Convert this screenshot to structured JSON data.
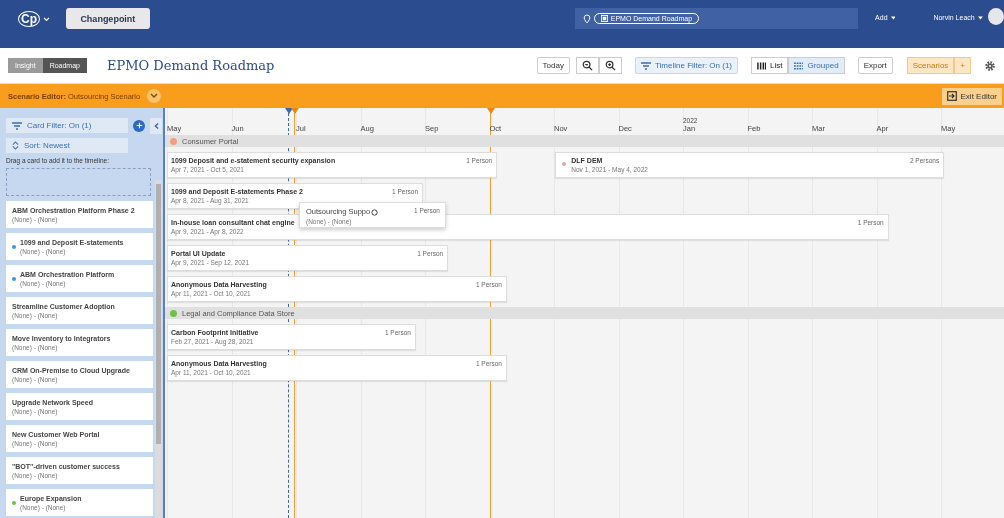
{
  "top_nav": {
    "logo": "Cp",
    "brand": "Changepoint",
    "breadcrumb": "EPMO Demand Roadmap",
    "add": "Add",
    "user": "Norvin Leach"
  },
  "toolbar": {
    "modes": [
      {
        "label": "Insight",
        "selected": false
      },
      {
        "label": "Roadmap",
        "selected": true
      }
    ],
    "title": "EPMO Demand Roadmap",
    "today": "Today",
    "timeline_filter": "Timeline Filter: On (1)",
    "views": [
      {
        "label": "List",
        "selected": false
      },
      {
        "label": "Grouped",
        "selected": true
      }
    ],
    "export": "Export",
    "scenarios": "Scenarios",
    "add_scenario": "+"
  },
  "scenario_bar": {
    "label": "Scenario Editor:",
    "name": "Outsourcing Scenario",
    "exit": "Exit Editor"
  },
  "sidebar": {
    "card_filter": "Card Filter: On (1)",
    "sort": "Sort: Newest",
    "hint": "Drag a card to add it to the timeline:",
    "cards": [
      {
        "title": "ABM Orchestration Platform Phase 2",
        "subtitle": "(None) - (None)"
      },
      {
        "title": "1099 and Deposit E-statements",
        "subtitle": "(None) - (None)",
        "color": "#3a9ad9"
      },
      {
        "title": "ABM Orchestration Platform",
        "subtitle": "(None) - (None)",
        "color": "#3a9ad9"
      },
      {
        "title": "Streamline Customer Adoption",
        "subtitle": "(None) - (None)"
      },
      {
        "title": "Move Inventory to Integrators",
        "subtitle": "(None) - (None)"
      },
      {
        "title": "CRM On-Premise to Cloud Upgrade",
        "subtitle": "(None) - (None)"
      },
      {
        "title": "Upgrade Network Speed",
        "subtitle": "(None) - (None)"
      },
      {
        "title": "New Customer Web Portal",
        "subtitle": "(None) - (None)"
      },
      {
        "title": "\"BOT\"-driven customer success",
        "subtitle": "(None) - (None)"
      },
      {
        "title": "Europe Expansion",
        "subtitle": "(None) - (None)",
        "color": "#6cc24a"
      }
    ]
  },
  "timeline": {
    "months": [
      {
        "label": "May"
      },
      {
        "label": "Jun"
      },
      {
        "label": "Jul"
      },
      {
        "label": "Aug"
      },
      {
        "label": "Sep"
      },
      {
        "label": "Oct"
      },
      {
        "label": "Nov"
      },
      {
        "label": "Dec"
      },
      {
        "label": "Jan",
        "year": "2022"
      },
      {
        "label": "Feb"
      },
      {
        "label": "Mar"
      },
      {
        "label": "Apr"
      },
      {
        "label": "May"
      }
    ],
    "groups": [
      {
        "name": "Consumer Portal",
        "color": "#f0a080",
        "rows": [
          {
            "items": [
              {
                "title": "1099 Deposit and e-statement security expansion",
                "dates": "Apr 7, 2021 - Oct 5, 2021",
                "people": "1 Person"
              },
              {
                "title": "DLF DEM",
                "dates": "Nov 1, 2021 - May 4, 2022",
                "people": "2 Persons",
                "color": "#e8a0a8"
              }
            ]
          },
          {
            "items": [
              {
                "title": "1099 and Deposit E-statements Phase 2",
                "dates": "Apr 8, 2021 - Aug 31, 2021",
                "people": "1 Person"
              }
            ]
          },
          {
            "items": [
              {
                "title": "In-house loan consultant chat engine",
                "dates": "Apr 9, 2021 - Apr 8, 2022",
                "people": "1 Person"
              }
            ]
          },
          {
            "items": [
              {
                "title": "Portal UI Update",
                "dates": "Apr 9, 2021 - Sep 12, 2021",
                "people": "1 Person"
              }
            ]
          },
          {
            "items": [
              {
                "title": "Anonymous Data Harvesting",
                "dates": "Apr 11, 2021 - Oct 10, 2021",
                "people": "1 Person"
              }
            ]
          }
        ]
      },
      {
        "name": "Legal and Compliance Data Store",
        "color": "#6cc24a",
        "rows": [
          {
            "items": [
              {
                "title": "Carbon Footprint Initiative",
                "dates": "Feb 27, 2021 - Aug 28, 2021",
                "people": "1 Person"
              }
            ]
          },
          {
            "items": [
              {
                "title": "Anonymous Data Harvesting",
                "dates": "Apr 11, 2021 - Oct 10, 2021",
                "people": "1 Person"
              }
            ]
          }
        ]
      }
    ],
    "dragged_card": {
      "title": "Outsourcing Suppo",
      "subtitle": "(None) - (None)",
      "people": "1 Person"
    }
  }
}
